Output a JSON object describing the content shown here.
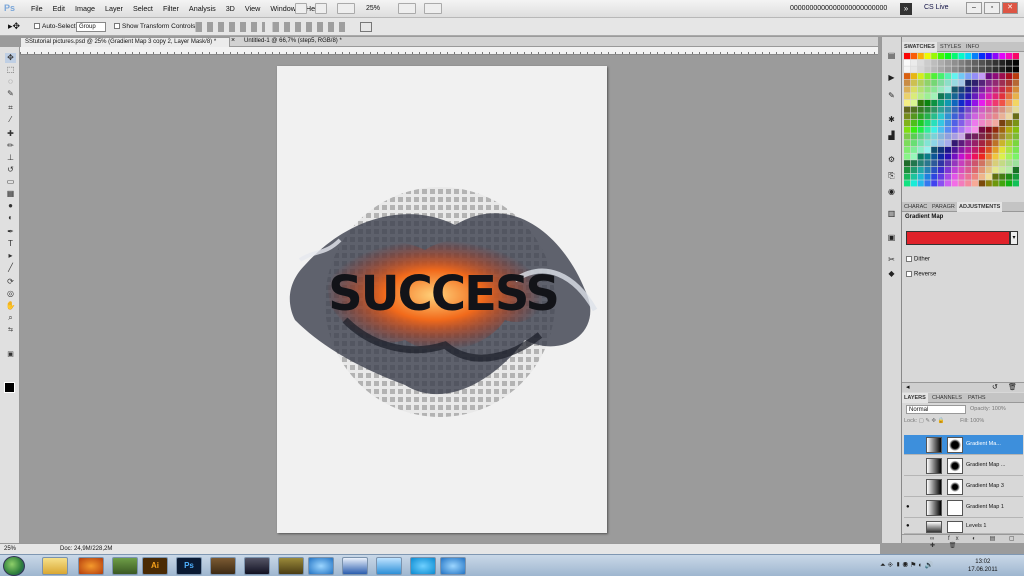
{
  "app": {
    "logo": "Ps",
    "menu": [
      "File",
      "Edit",
      "Image",
      "Layer",
      "Select",
      "Filter",
      "Analysis",
      "3D",
      "View",
      "Window",
      "Help"
    ],
    "zoom": "25%",
    "doc_title_bar": "0000000000000000000000000",
    "cs_live": "CS Live"
  },
  "options": {
    "auto_select": "Auto-Select:",
    "group": "Group",
    "transform": "Show Transform Controls"
  },
  "tabs": [
    {
      "label": "SStutorial pictures.psd @ 25% (Gradient Map 3 copy 2, Layer Mask/8) *"
    },
    {
      "label": "Untitled-1 @ 66,7% (step5, RGB/8) *"
    }
  ],
  "canvas": {
    "text": "SUCCESS"
  },
  "status": {
    "zoom": "25%",
    "doc": "Doc: 24,9M/228,2M"
  },
  "panels": {
    "swatches_tabs": [
      "SWATCHES",
      "STYLES",
      "INFO"
    ],
    "adj_tabs": [
      "CHARAC",
      "PARAGR",
      "ADJUSTMENTS"
    ],
    "adj_title": "Gradient Map",
    "dither": "Dither",
    "reverse": "Reverse",
    "gradient_color": "#e0222a",
    "layers_tabs": [
      "LAYERS",
      "CHANNELS",
      "PATHS"
    ],
    "blend": "Normal",
    "opacity": "Opacity: 100%",
    "lock": "Lock:",
    "fill": "Fill: 100%",
    "layers": [
      {
        "name": "Gradient Ma..."
      },
      {
        "name": "Gradient Map ..."
      },
      {
        "name": "Gradient Map 3"
      },
      {
        "name": "Gradient Map 1"
      },
      {
        "name": "Levels 1"
      }
    ]
  },
  "taskbar": {
    "items": [
      "",
      "",
      "",
      "",
      "Ai",
      "Ps",
      "",
      "",
      "",
      "",
      "",
      "",
      "",
      "",
      ""
    ],
    "time": "13:02",
    "date": "17.06.2011"
  }
}
